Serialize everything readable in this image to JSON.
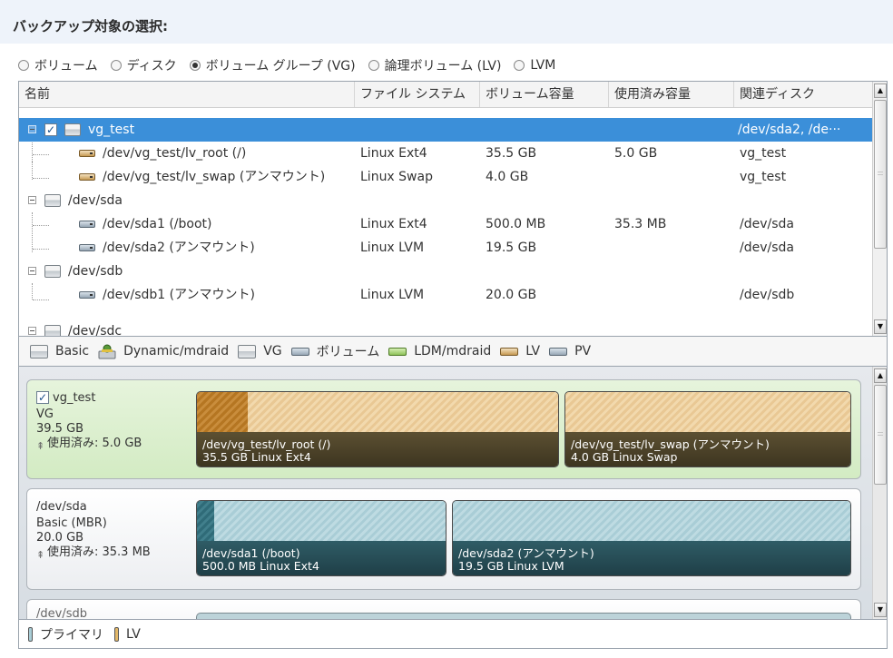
{
  "title": "バックアップ対象の選択:",
  "radio_options": [
    {
      "label": "ボリューム",
      "selected": false
    },
    {
      "label": "ディスク",
      "selected": false
    },
    {
      "label": "ボリューム グループ (VG)",
      "selected": true
    },
    {
      "label": "論理ボリューム (LV)",
      "selected": false
    },
    {
      "label": "LVM",
      "selected": false
    }
  ],
  "table": {
    "columns": [
      "名前",
      "ファイル システム",
      "ボリューム容量",
      "使用済み容量",
      "関連ディスク"
    ],
    "rows": [
      {
        "name": "vg_test",
        "fs": "",
        "size": "",
        "used": "",
        "disk": "/dev/sda2, /de···",
        "selected": true,
        "checked": true,
        "icon": "vg-icon"
      },
      {
        "name": "/dev/vg_test/lv_root (/)",
        "fs": "Linux Ext4",
        "size": "35.5 GB",
        "used": "5.0 GB",
        "disk": "vg_test",
        "icon": "lv-icon"
      },
      {
        "name": "/dev/vg_test/lv_swap (アンマウント)",
        "fs": "Linux Swap",
        "size": "4.0 GB",
        "used": "",
        "disk": "vg_test",
        "icon": "lv-icon"
      },
      {
        "name": "/dev/sda",
        "fs": "",
        "size": "",
        "used": "",
        "disk": "",
        "icon": "disk-icon"
      },
      {
        "name": "/dev/sda1 (/boot)",
        "fs": "Linux Ext4",
        "size": "500.0 MB",
        "used": "35.3 MB",
        "disk": "/dev/sda",
        "icon": "volume-icon"
      },
      {
        "name": "/dev/sda2 (アンマウント)",
        "fs": "Linux LVM",
        "size": "19.5 GB",
        "used": "",
        "disk": "/dev/sda",
        "icon": "volume-icon"
      },
      {
        "name": "/dev/sdb",
        "fs": "",
        "size": "",
        "used": "",
        "disk": "",
        "icon": "disk-icon"
      },
      {
        "name": "/dev/sdb1 (アンマウント)",
        "fs": "Linux LVM",
        "size": "20.0 GB",
        "used": "",
        "disk": "/dev/sdb",
        "icon": "volume-icon"
      },
      {
        "name": "/dev/sdc",
        "fs": "",
        "size": "",
        "used": "",
        "disk": "",
        "icon": "disk-icon"
      }
    ]
  },
  "legend": [
    "Basic",
    "Dynamic/mdraid",
    "VG",
    "ボリューム",
    "LDM/mdraid",
    "LV",
    "PV"
  ],
  "map": {
    "vg": {
      "name": "vg_test",
      "type": "VG",
      "size": "39.5 GB",
      "used": "使用済み: 5.0 GB",
      "checked": true,
      "parts": [
        {
          "path": "/dev/vg_test/lv_root (/)",
          "info": "35.5 GB Linux Ext4",
          "used_fraction": 0.14
        },
        {
          "path": "/dev/vg_test/lv_swap (アンマウント)",
          "info": "4.0 GB Linux Swap",
          "used_fraction": 0
        }
      ]
    },
    "sda": {
      "name": "/dev/sda",
      "type": "Basic (MBR)",
      "size": "20.0 GB",
      "used": "使用済み: 35.3 MB",
      "parts": [
        {
          "path": "/dev/sda1 (/boot)",
          "info": "500.0 MB Linux Ext4",
          "used_fraction": 0.07
        },
        {
          "path": "/dev/sda2 (アンマウント)",
          "info": "19.5 GB Linux LVM",
          "used_fraction": 0
        }
      ]
    },
    "sdb": {
      "name": "/dev/sdb"
    }
  },
  "footer": {
    "primary": "プライマリ",
    "lv": "LV"
  },
  "colors": {
    "selection": "#3b8fd9",
    "vg_card": "#dff0d4",
    "lv_fill": "#e9c894",
    "pv_fill": "#a9cdd6"
  }
}
